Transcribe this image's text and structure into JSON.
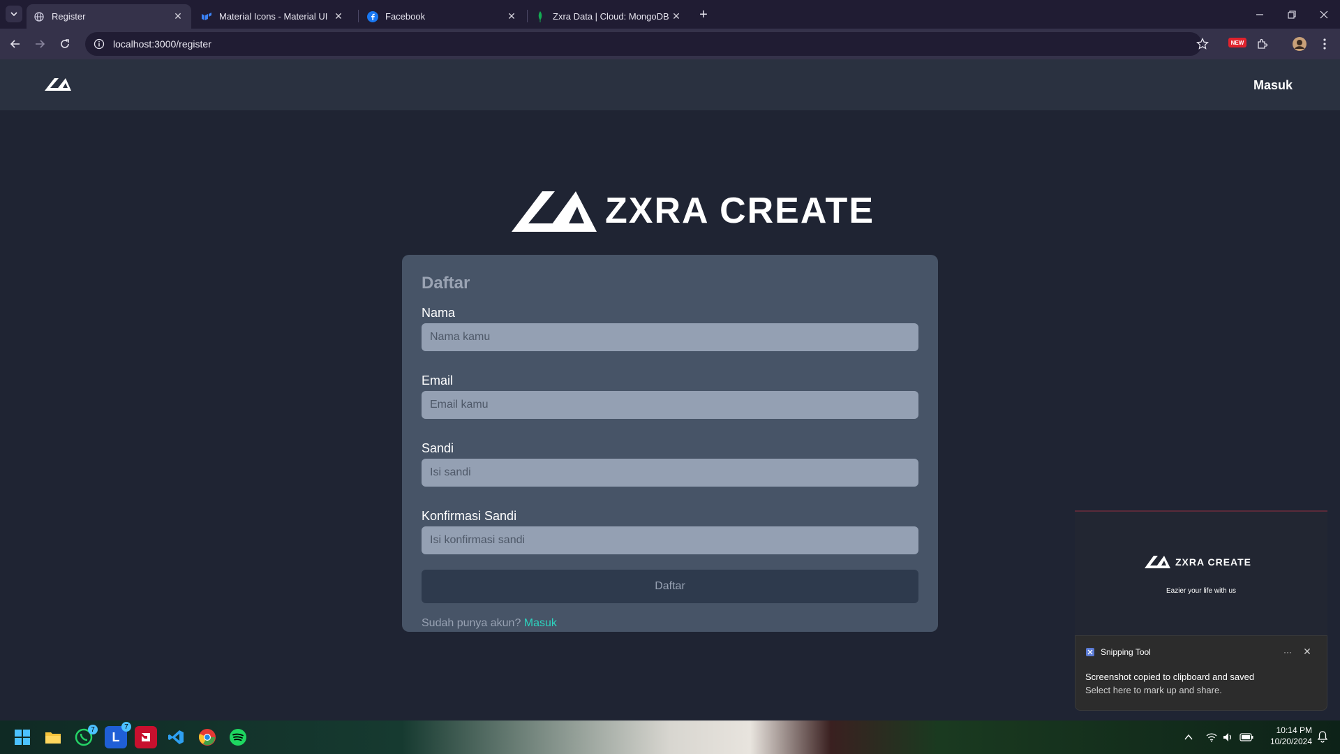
{
  "browser": {
    "tabs": [
      {
        "title": "Register",
        "active": true
      },
      {
        "title": "Material Icons - Material UI",
        "active": false
      },
      {
        "title": "Facebook",
        "active": false
      },
      {
        "title": "Zxra Data | Cloud: MongoDB Cl",
        "active": false
      }
    ],
    "url": "localhost:3000/register",
    "new_badge": "NEW"
  },
  "nav": {
    "login_label": "Masuk"
  },
  "brand": {
    "name": "ZXRA CREATE"
  },
  "form": {
    "title": "Daftar",
    "fields": [
      {
        "label": "Nama",
        "placeholder": "Nama kamu"
      },
      {
        "label": "Email",
        "placeholder": "Email kamu"
      },
      {
        "label": "Sandi",
        "placeholder": "Isi sandi"
      },
      {
        "label": "Konfirmasi Sandi",
        "placeholder": "Isi konfirmasi sandi"
      }
    ],
    "submit_label": "Daftar",
    "footer_text": "Sudah punya akun? ",
    "footer_link": "Masuk"
  },
  "preview": {
    "brand": "ZXRA CREATE",
    "tagline": "Eazier your life with us"
  },
  "toast": {
    "app_name": "Snipping Tool",
    "line1": "Screenshot copied to clipboard and saved",
    "line2": "Select here to mark up and share."
  },
  "taskbar": {
    "time": "10:14 PM",
    "date": "10/20/2024",
    "whatsapp_badge": "7",
    "app_badge": "7"
  },
  "colors": {
    "accent_link": "#2dd4bf",
    "card_bg": "#475467",
    "page_bg": "#1f2433"
  }
}
